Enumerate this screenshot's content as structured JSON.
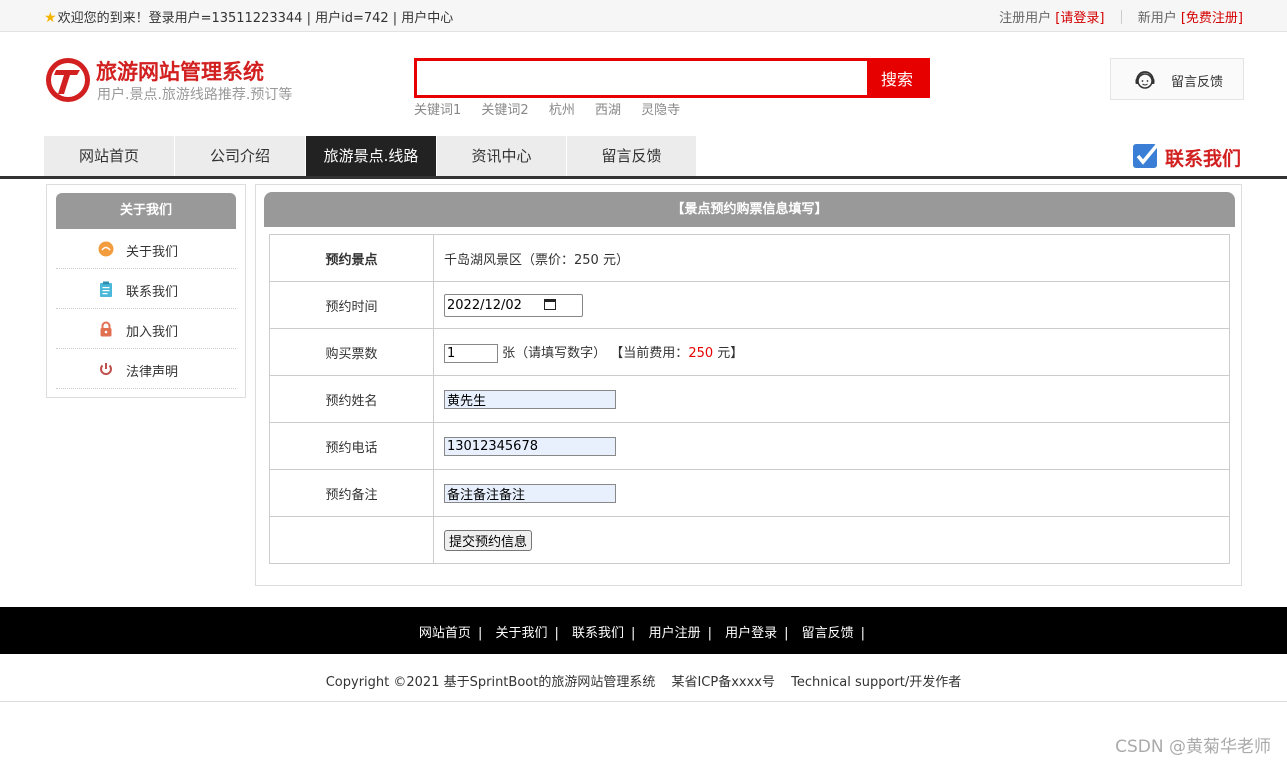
{
  "topbar": {
    "welcome": "欢迎您的到来！登录用户=13511223344 | 用户id=742 | 用户中心",
    "register_label": "注册用户",
    "login_link": "[请登录]",
    "new_user_label": "新用户",
    "free_register_link": "[免费注册]"
  },
  "header": {
    "site_title": "旅游网站管理系统",
    "site_subtitle": "用户.景点.旅游线路推荐.预订等",
    "search_button": "搜索",
    "search_value": "",
    "keywords": [
      "关键词1",
      "关键词2",
      "杭州",
      "西湖",
      "灵隐寺"
    ],
    "feedback_label": "留言反馈"
  },
  "nav": {
    "items": [
      {
        "label": "网站首页"
      },
      {
        "label": "公司介绍"
      },
      {
        "label": "旅游景点.线路"
      },
      {
        "label": "资讯中心"
      },
      {
        "label": "留言反馈"
      }
    ],
    "active_index": 2,
    "contact_label": "联系我们"
  },
  "sidebar": {
    "title": "关于我们",
    "items": [
      {
        "label": "关于我们",
        "icon": "orange-circle-icon",
        "color": "#f39c3d"
      },
      {
        "label": "联系我们",
        "icon": "clipboard-icon",
        "color": "#4ab8d8"
      },
      {
        "label": "加入我们",
        "icon": "lock-icon",
        "color": "#e07050"
      },
      {
        "label": "法律声明",
        "icon": "power-icon",
        "color": "#c0504d"
      }
    ]
  },
  "form": {
    "title": "【景点预约购票信息填写】",
    "spot_label": "预约景点",
    "spot_value": "千岛湖风景区（票价：250 元）",
    "time_label": "预约时间",
    "time_value": "2022/12/02",
    "qty_label": "购买票数",
    "qty_value": "1",
    "qty_suffix": "张（请填写数字）",
    "fee_prefix": "【当前费用：",
    "fee_value": "250",
    "fee_suffix": " 元】",
    "name_label": "预约姓名",
    "name_value": "黄先生",
    "phone_label": "预约电话",
    "phone_value": "13012345678",
    "note_label": "预约备注",
    "note_value": "备注备注备注",
    "submit_label": "提交预约信息"
  },
  "footer": {
    "links": [
      "网站首页",
      "关于我们",
      "联系我们",
      "用户注册",
      "用户登录",
      "留言反馈"
    ],
    "separator": "|",
    "copyright": "Copyright ©2021 基于SprintBoot的旅游网站管理系统",
    "icp": "某省ICP备xxxx号",
    "support": "Technical support/开发作者"
  },
  "watermark": "CSDN @黄菊华老师",
  "colors": {
    "brand_red": "#d21f1f",
    "search_red": "#e60000",
    "nav_active": "#222222",
    "panel_gray": "#999999"
  }
}
